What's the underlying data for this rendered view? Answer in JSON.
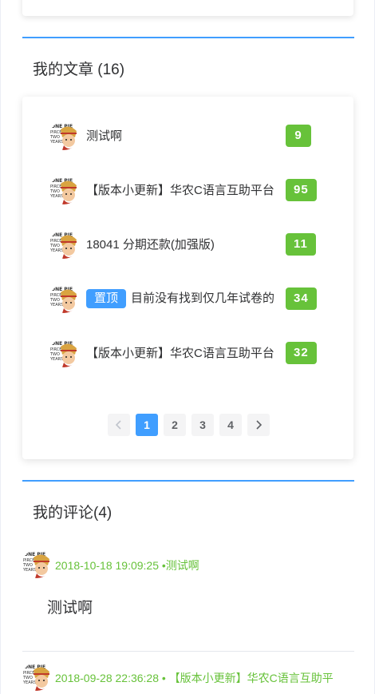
{
  "articles_section": {
    "title": "我的文章 (16)",
    "items": [
      {
        "title": "测试啊",
        "pinned": false,
        "count": "9"
      },
      {
        "title": "【版本小更新】华农C语言互助平台",
        "pinned": false,
        "count": "95"
      },
      {
        "title": "18041 分期还款(加强版)",
        "pinned": false,
        "count": "11"
      },
      {
        "title": "目前没有找到仅几年试卷的",
        "pinned": true,
        "pin_label": "置顶",
        "count": "34"
      },
      {
        "title": "【版本小更新】华农C语言互助平台",
        "pinned": false,
        "count": "32"
      }
    ],
    "pagination": {
      "prev_icon": "chevron-left-icon",
      "next_icon": "chevron-right-icon",
      "pages": [
        "1",
        "2",
        "3",
        "4"
      ],
      "current": "1"
    }
  },
  "comments_section": {
    "title": "我的评论(4)",
    "items": [
      {
        "time": "2018-10-18 19:09:25",
        "separator": "•",
        "article": "测试啊",
        "body": "测试啊"
      },
      {
        "time": "2018-09-28 22:36:28",
        "separator": "•",
        "article": "【版本小更新】华农C语言互助平",
        "body": ""
      }
    ]
  },
  "colors": {
    "primary": "#409eff",
    "success": "#67c23a",
    "text": "#303133",
    "divider": "#e4e7ed"
  }
}
